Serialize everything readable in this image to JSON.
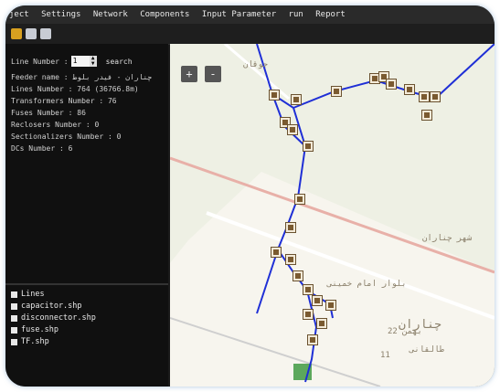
{
  "menu": [
    "ject",
    "Settings",
    "Network",
    "Components",
    "Input Parameter",
    "run",
    "Report"
  ],
  "info": {
    "line_number_label": "Line Number :",
    "line_number_value": "1",
    "search_label": "search",
    "feeder_label": "Feeder name :",
    "feeder_value": "چناران - فیدر بلوط",
    "lines_label": "Lines Number :",
    "lines_value": "764 (36766.8m)",
    "transformers_label": "Transformers Number :",
    "transformers_value": "76",
    "fuses_label": "Fuses Number :",
    "fuses_value": "86",
    "reclosers_label": "Reclosers Number :",
    "reclosers_value": "0",
    "sectionalizers_label": "Sectionalizers Number :",
    "sectionalizers_value": "0",
    "dcs_label": "DCs Number :",
    "dcs_value": "6"
  },
  "layers": [
    "Lines",
    "capacitor.shp",
    "disconnector.shp",
    "fuse.shp",
    "TF.shp"
  ],
  "map": {
    "zoom_in": "+",
    "zoom_out": "-",
    "labels": [
      "جوقان",
      "چناران",
      "بلوار امام خمینی",
      "شهر چناران",
      "22 بهمن",
      "طالقانی",
      "11"
    ]
  },
  "colors": {
    "feeder_line": "#1f2fd6",
    "background": "#101010",
    "map_bg": "#eef0e4"
  }
}
